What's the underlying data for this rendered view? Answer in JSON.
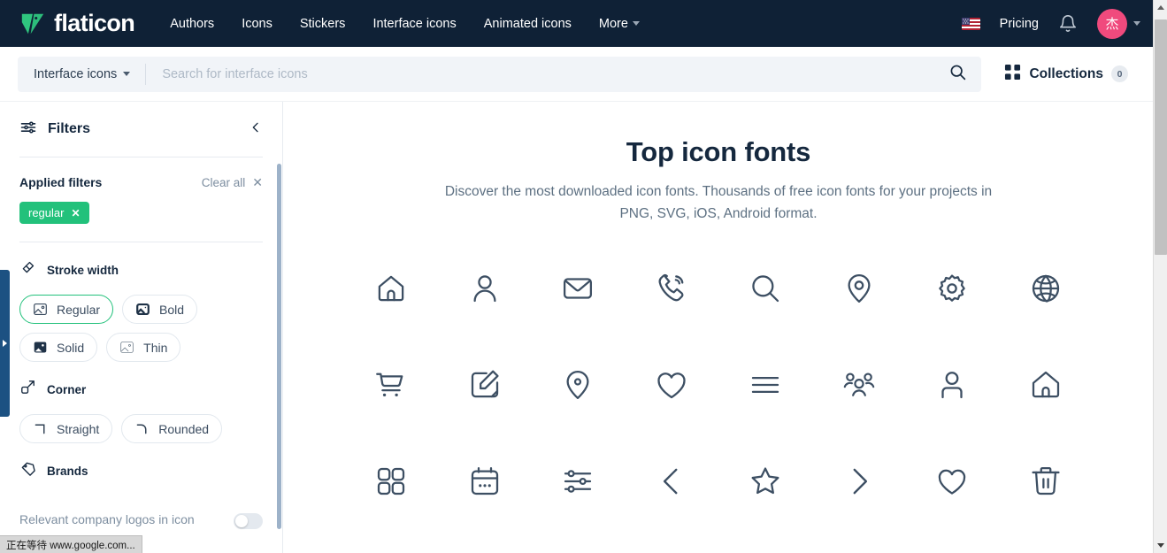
{
  "theme": {
    "nav_bg": "#0f2136",
    "accent_green": "#22c17b",
    "avatar_pink": "#f04a7d",
    "text_dark": "#15283e",
    "text_muted": "#7d8ea0",
    "icon_color": "#3d4f63",
    "blue_tab": "#1c5182"
  },
  "topnav": {
    "brand": "flaticon",
    "brand_icon": "flaticon-logo-icon",
    "links": [
      {
        "label": "Authors",
        "name": "nav-link-authors"
      },
      {
        "label": "Icons",
        "name": "nav-link-icons"
      },
      {
        "label": "Stickers",
        "name": "nav-link-stickers"
      },
      {
        "label": "Interface icons",
        "name": "nav-link-interface-icons"
      },
      {
        "label": "Animated icons",
        "name": "nav-link-animated-icons"
      },
      {
        "label": "More",
        "name": "nav-link-more"
      }
    ],
    "language_icon": "us-flag-icon",
    "pricing": "Pricing",
    "notifications_icon": "bell-icon",
    "avatar_initial": "杰",
    "avatar_caret_icon": "chevron-down-icon"
  },
  "search": {
    "category": "Interface icons",
    "category_caret_icon": "chevron-down-icon",
    "placeholder": "Search for interface icons",
    "value": "",
    "submit_icon": "search-icon",
    "collections_icon": "grid-icon",
    "collections_label": "Collections",
    "collections_count": "0"
  },
  "sidebar": {
    "header": {
      "icon": "filters-sliders-icon",
      "title": "Filters",
      "collapse_icon": "chevron-left-icon"
    },
    "applied": {
      "title": "Applied filters",
      "clear_all": "Clear all",
      "clear_all_icon": "close-icon",
      "chips": [
        {
          "label": "regular",
          "remove_icon": "close-icon"
        }
      ]
    },
    "groups": [
      {
        "name": "stroke-width",
        "icon": "stroke-width-icon",
        "title": "Stroke width",
        "options": [
          {
            "label": "Regular",
            "icon": "image-outline-icon",
            "active": true
          },
          {
            "label": "Bold",
            "icon": "image-bold-icon",
            "active": false
          },
          {
            "label": "Solid",
            "icon": "image-solid-icon",
            "active": false
          },
          {
            "label": "Thin",
            "icon": "image-thin-icon",
            "active": false
          }
        ]
      },
      {
        "name": "corner",
        "icon": "corner-icon",
        "title": "Corner",
        "options": [
          {
            "label": "Straight",
            "icon": "corner-straight-icon",
            "active": false
          },
          {
            "label": "Rounded",
            "icon": "corner-rounded-icon",
            "active": false
          }
        ]
      }
    ],
    "brands": {
      "icon": "tag-icon",
      "title": "Brands",
      "description": "Relevant company logos in icon font format.",
      "toggle_on": false
    },
    "side_handle_icon": "expand-arrow-icon"
  },
  "main": {
    "title": "Top icon fonts",
    "subtitle": "Discover the most downloaded icon fonts. Thousands of free icon fonts for your projects in PNG, SVG, iOS, Android format.",
    "icons": [
      {
        "name": "home-icon"
      },
      {
        "name": "user-icon"
      },
      {
        "name": "envelope-icon"
      },
      {
        "name": "phone-ringing-icon"
      },
      {
        "name": "search-icon"
      },
      {
        "name": "location-pin-icon"
      },
      {
        "name": "gear-icon"
      },
      {
        "name": "globe-icon"
      },
      {
        "name": "shopping-cart-icon"
      },
      {
        "name": "edit-square-icon"
      },
      {
        "name": "location-pin-filled-dot-icon"
      },
      {
        "name": "heart-icon"
      },
      {
        "name": "hamburger-menu-icon"
      },
      {
        "name": "users-group-icon"
      },
      {
        "name": "user-square-icon"
      },
      {
        "name": "home-alt-icon"
      },
      {
        "name": "grid-four-icon"
      },
      {
        "name": "calendar-icon"
      },
      {
        "name": "sliders-icon"
      },
      {
        "name": "chevron-left-icon"
      },
      {
        "name": "star-icon"
      },
      {
        "name": "chevron-right-icon"
      },
      {
        "name": "heart-alt-icon"
      },
      {
        "name": "trash-icon"
      }
    ]
  },
  "browser": {
    "status_text": "正在等待 www.google.com...",
    "scroll_up_icon": "caret-up-icon",
    "scroll_down_icon": "caret-down-icon"
  }
}
